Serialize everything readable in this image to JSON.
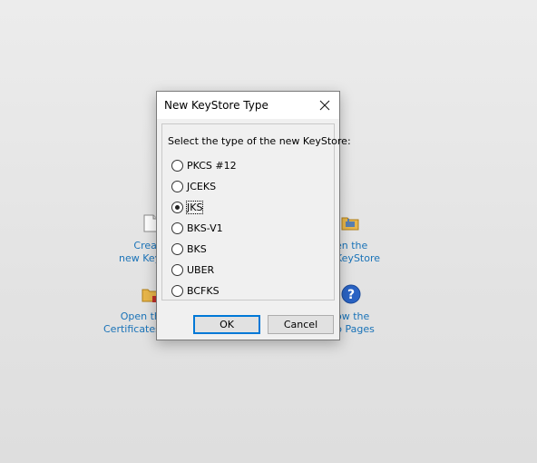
{
  "background": {
    "create_link": [
      "Creat",
      "new Key"
    ],
    "open_link": [
      "en the",
      "KeyStore"
    ],
    "certs_link": [
      "Open th",
      "Certificates"
    ],
    "help_link": [
      "ow the",
      "p Pages"
    ],
    "icons": [
      "new-file-icon",
      "open-folder-icon",
      "certificate-folder-icon",
      "help-icon"
    ],
    "link_color": "#1a73b8"
  },
  "dialog": {
    "title": "New KeyStore Type",
    "prompt": "Select the type of the new KeyStore:",
    "options": [
      {
        "label": "PKCS #12",
        "selected": false
      },
      {
        "label": "JCEKS",
        "selected": false
      },
      {
        "label": "JKS",
        "selected": true
      },
      {
        "label": "BKS-V1",
        "selected": false
      },
      {
        "label": "BKS",
        "selected": false
      },
      {
        "label": "UBER",
        "selected": false
      },
      {
        "label": "BCFKS",
        "selected": false
      }
    ],
    "ok_label": "OK",
    "cancel_label": "Cancel",
    "accent_color": "#0078d7"
  }
}
